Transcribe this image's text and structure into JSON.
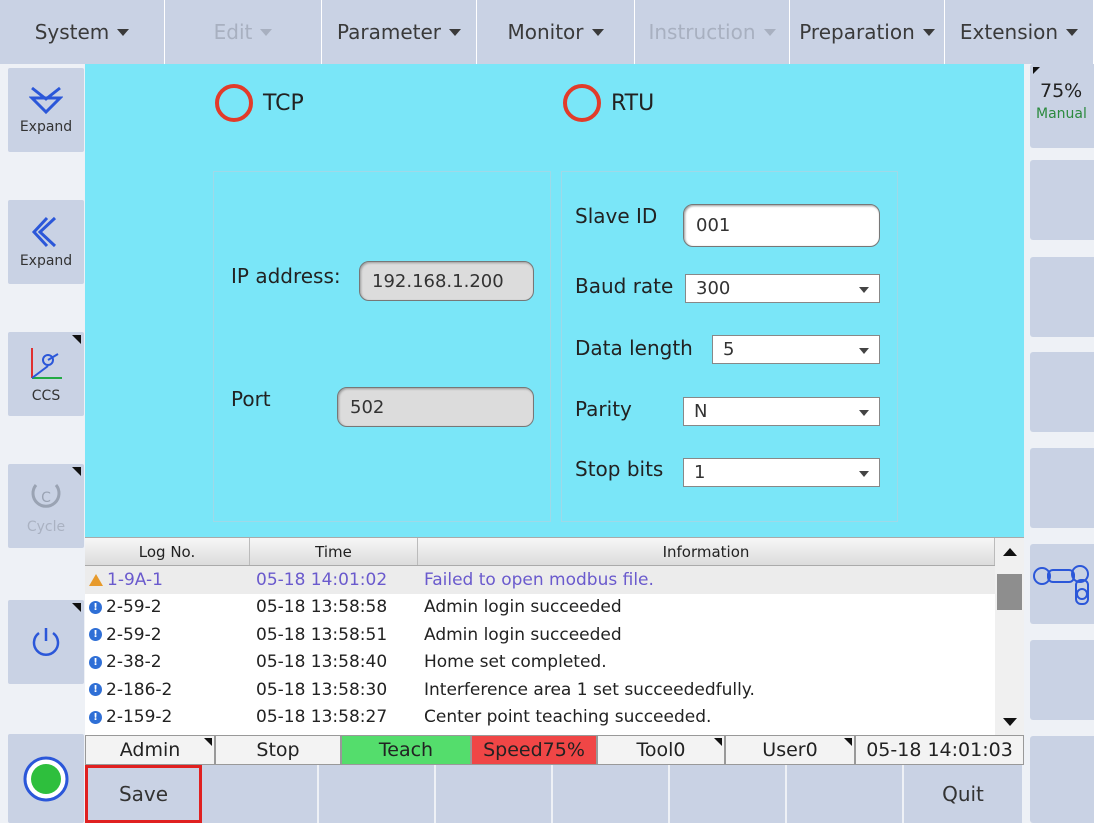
{
  "menu": {
    "items": [
      {
        "label": "System",
        "disabled": false
      },
      {
        "label": "Edit",
        "disabled": true
      },
      {
        "label": "Parameter",
        "disabled": false
      },
      {
        "label": "Monitor",
        "disabled": false
      },
      {
        "label": "Instruction",
        "disabled": true
      },
      {
        "label": "Preparation",
        "disabled": false
      },
      {
        "label": "Extension",
        "disabled": false
      }
    ]
  },
  "left": {
    "expand1_label": "Expand",
    "expand2_label": "Expand",
    "ccs_label": "CCS",
    "cycle_label": "Cycle"
  },
  "right": {
    "speed_value": "75%",
    "mode_label": "Manual"
  },
  "panel": {
    "tcp_label": "TCP",
    "rtu_label": "RTU",
    "ip_label": "IP address:",
    "ip_value": "192.168.1.200",
    "port_label": "Port",
    "port_value": "502",
    "slave_label": "Slave ID",
    "slave_value": "001",
    "baud_label": "Baud rate",
    "baud_value": "300",
    "datalen_label": "Data length",
    "datalen_value": "5",
    "parity_label": "Parity",
    "parity_value": "N",
    "stopbits_label": "Stop bits",
    "stopbits_value": "1"
  },
  "log": {
    "headers": [
      "Log No.",
      "Time",
      "Information"
    ],
    "rows": [
      {
        "type": "warn",
        "no": "1-9A-1",
        "time": "05-18 14:01:02",
        "info": "Failed to open modbus file."
      },
      {
        "type": "info",
        "no": "2-59-2",
        "time": "05-18 13:58:58",
        "info": "Admin  login succeeded"
      },
      {
        "type": "info",
        "no": "2-59-2",
        "time": "05-18 13:58:51",
        "info": "Admin  login succeeded"
      },
      {
        "type": "info",
        "no": "2-38-2",
        "time": "05-18 13:58:40",
        "info": "Home set completed."
      },
      {
        "type": "info",
        "no": "2-186-2",
        "time": "05-18 13:58:30",
        "info": "Interference area 1 set succeededfully."
      },
      {
        "type": "info",
        "no": "2-159-2",
        "time": "05-18 13:58:27",
        "info": "Center point teaching succeeded."
      }
    ]
  },
  "status": {
    "user": "Admin",
    "run": "Stop",
    "mode": "Teach",
    "speed": "Speed75%",
    "tool": "Tool0",
    "userframe": "User0",
    "datetime": "05-18 14:01:03",
    "colors": {
      "teach": "#54dd6c",
      "speed": "#f04646"
    }
  },
  "bottom": {
    "save_label": "Save",
    "quit_label": "Quit"
  }
}
